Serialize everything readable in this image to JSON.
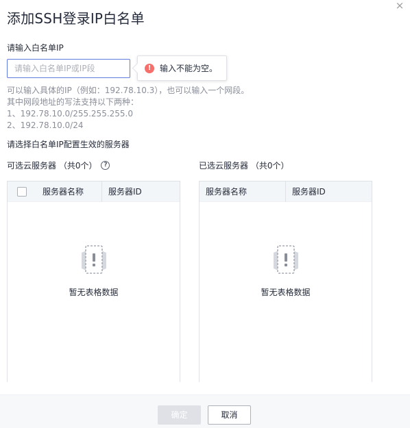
{
  "dialog": {
    "title": "添加SSH登录IP白名单",
    "close_glyph": "×"
  },
  "whitelist": {
    "label": "请输入白名单IP",
    "input_value": "",
    "placeholder": "请输入白名单IP或IP段",
    "error_tip": "输入不能为空。",
    "hint_lines": [
      "可以输入具体的IP（例如：192.78.10.3），也可以输入一个网段。",
      "其中网段地址的写法支持以下两种：",
      "1、192.78.10.0/255.255.255.0",
      "2、192.78.10.0/24"
    ]
  },
  "servers": {
    "section_label": "请选择白名单IP配置生效的服务器",
    "available": {
      "label": "可选云服务器 （共0个）",
      "columns": [
        "服务器名称",
        "服务器ID"
      ],
      "empty_text": "暂无表格数据"
    },
    "selected": {
      "label": "已选云服务器 （共0个）",
      "columns": [
        "服务器名称",
        "服务器ID"
      ],
      "empty_text": "暂无表格数据"
    }
  },
  "footer": {
    "confirm_label": "确定",
    "cancel_label": "取消"
  },
  "colors": {
    "accent": "#5e7ce0",
    "error": "#f66f6a",
    "disabled_button": "#dfe1e6",
    "table_header": "#f3f6f8"
  },
  "icons": {
    "close": "close-icon",
    "error": "error-circle-icon",
    "help": "help-circle-icon",
    "empty": "empty-table-icon"
  }
}
